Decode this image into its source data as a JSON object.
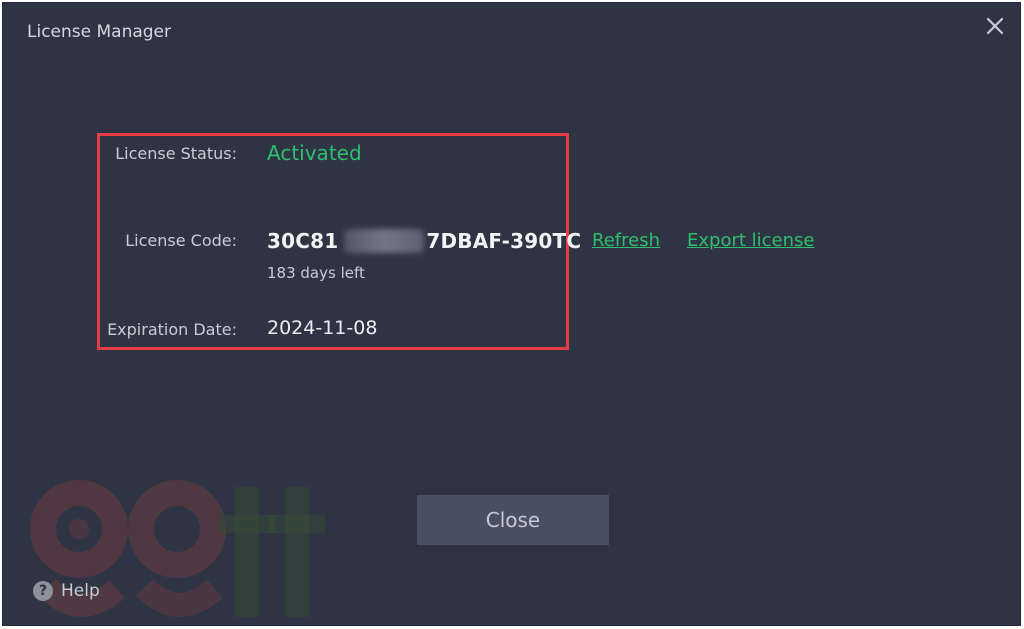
{
  "window": {
    "title": "License Manager",
    "close_icon": "close-icon"
  },
  "license": {
    "status_label": "License Status:",
    "status_value": "Activated",
    "code_label": "License Code:",
    "code_prefix": "30C81",
    "code_suffix": "7DBAF-390TC",
    "days_left": "183 days left",
    "expiration_label": "Expiration Date:",
    "expiration_value": "2024-11-08",
    "refresh_label": "Refresh",
    "export_label": "Export license"
  },
  "footer": {
    "close_label": "Close",
    "help_label": "Help",
    "help_icon": "question-circle-icon"
  },
  "colors": {
    "background": "#2f3445",
    "accent_green": "#2fbf6c",
    "highlight_red": "#e53d43",
    "button_bg": "#4a5064"
  }
}
